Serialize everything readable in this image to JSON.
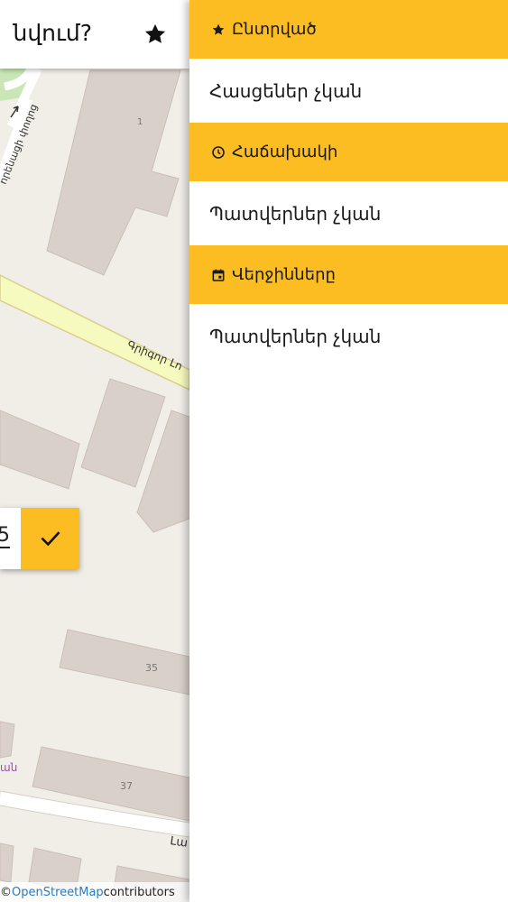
{
  "search": {
    "query_visible": "նվում?",
    "star_icon": "star-icon"
  },
  "map": {
    "street_labels": [
      "որենացի փողոց",
      "Գրիգոր Լո",
      "Լա"
    ],
    "building_numbers": [
      "1",
      "35",
      "37"
    ],
    "poi_label": "ան"
  },
  "confirm": {
    "value_visible": "5",
    "check_icon": "check-icon"
  },
  "attribution": {
    "prefix": "© ",
    "link": "OpenStreetMap",
    "suffix": " contributors"
  },
  "drawer": {
    "sections": [
      {
        "icon": "star-icon",
        "title": "Ընտրված",
        "empty_text": "Հասցեներ չկան"
      },
      {
        "icon": "clock-icon",
        "title": "Հաճախակի",
        "empty_text": "Պատվերներ չկան"
      },
      {
        "icon": "calendar-icon",
        "title": "Վերջինները",
        "empty_text": "Պատվերներ չկան"
      }
    ]
  },
  "colors": {
    "accent": "#fbbd22",
    "map_background": "#f1eee8",
    "building": "#d9d0c9",
    "main_road": "#f7fabf",
    "link": "#2a7bbf"
  }
}
